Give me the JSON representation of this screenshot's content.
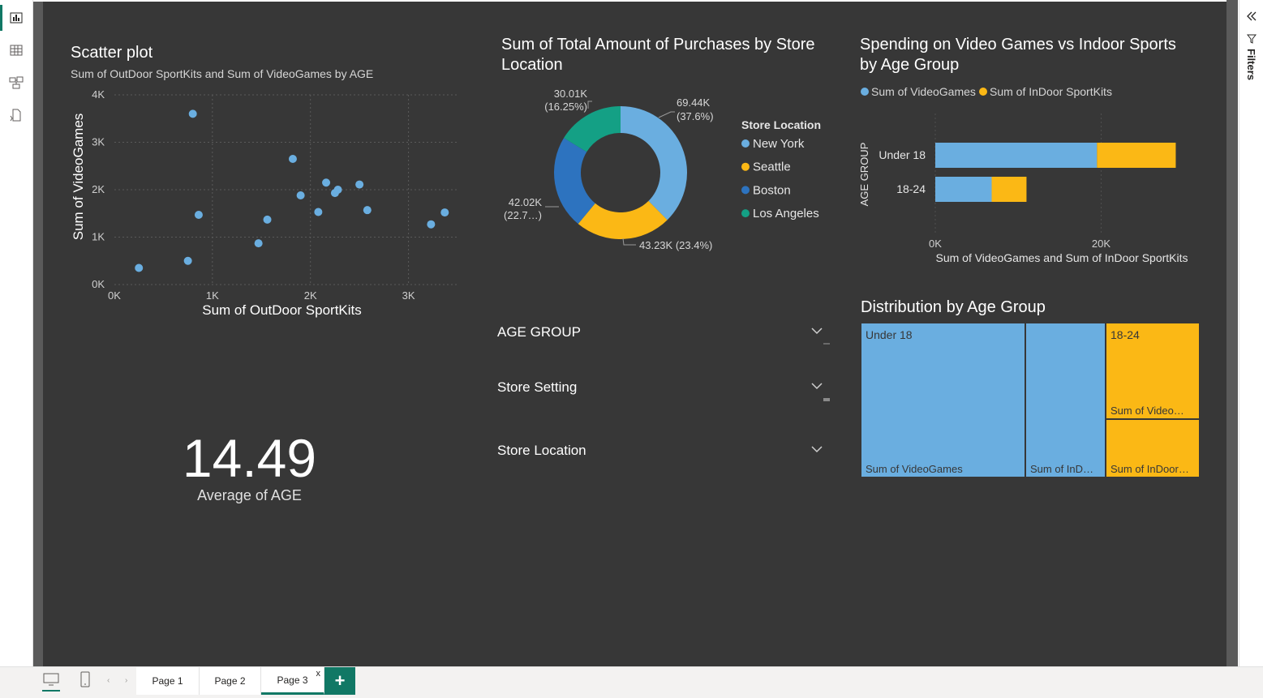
{
  "nav": {
    "items": [
      {
        "name": "report-view-icon",
        "active": true
      },
      {
        "name": "table-view-icon",
        "active": false
      },
      {
        "name": "model-view-icon",
        "active": false
      },
      {
        "name": "dax-query-icon",
        "active": false
      }
    ]
  },
  "filters_pane": {
    "label": "Filters"
  },
  "colors": {
    "canvas": "#373737",
    "accent": "#117865",
    "blue_light": "#6aaee0",
    "yellow": "#fbb815",
    "blue_dark": "#2d73bf",
    "teal": "#14a085"
  },
  "scatter": {
    "title": "Scatter plot",
    "subtitle": "Sum of OutDoor SportKits and Sum of VideoGames by AGE"
  },
  "kpi": {
    "value": "14.49",
    "label": "Average of AGE"
  },
  "donut": {
    "title_line1": "Sum of Total Amount of Purchases by Store",
    "title_line2": "Location",
    "legend_title": "Store Location",
    "labels": {
      "ny_1": "69.44K",
      "ny_2": "(37.6%)",
      "sea": "43.23K (23.4%)",
      "bos_1": "42.02K",
      "bos_2": "(22.7…)",
      "la_1": "30.01K",
      "la_2": "(16.25%)"
    }
  },
  "slicers": [
    {
      "label": "AGE GROUP"
    },
    {
      "label": "Store Setting"
    },
    {
      "label": "Store Location"
    }
  ],
  "stacked": {
    "title_line1": "Spending on Video Games vs Indoor Sports",
    "title_line2": "by Age Group",
    "legend": [
      "Sum of VideoGames",
      "Sum of InDoor SportKits"
    ],
    "ylabel": "AGE GROUP",
    "xlabel": "Sum of VideoGames and Sum of InDoor SportKits",
    "ticks": [
      "0K",
      "20K"
    ]
  },
  "treemap": {
    "title": "Distribution by Age Group",
    "labels": {
      "under18": "Under 18",
      "u18_vg": "Sum of VideoGames",
      "u18_in": "Sum of InD…",
      "g1824": "18-24",
      "g1824_vg": "Sum of Video…",
      "g1824_in": "Sum of InDoor…"
    }
  },
  "pages": {
    "tabs": [
      "Page 1",
      "Page 2",
      "Page 3"
    ],
    "active": "Page 3",
    "close": "x",
    "add": "+"
  },
  "chart_data": [
    {
      "type": "scatter",
      "title": "Scatter plot",
      "subtitle": "Sum of OutDoor SportKits and Sum of VideoGames by AGE",
      "xlabel": "Sum of OutDoor SportKits",
      "ylabel": "Sum of VideoGames",
      "x_ticks": [
        "0K",
        "1K",
        "2K",
        "3K"
      ],
      "y_ticks": [
        "0K",
        "1K",
        "2K",
        "3K",
        "4K"
      ],
      "xlim": [
        0,
        3500
      ],
      "ylim": [
        0,
        4000
      ],
      "grid": true,
      "points": [
        {
          "x": 250,
          "y": 350
        },
        {
          "x": 750,
          "y": 500
        },
        {
          "x": 800,
          "y": 3600
        },
        {
          "x": 860,
          "y": 1470
        },
        {
          "x": 1470,
          "y": 870
        },
        {
          "x": 1560,
          "y": 1370
        },
        {
          "x": 1820,
          "y": 2650
        },
        {
          "x": 1900,
          "y": 1880
        },
        {
          "x": 2080,
          "y": 1530
        },
        {
          "x": 2160,
          "y": 2150
        },
        {
          "x": 2250,
          "y": 1930
        },
        {
          "x": 2280,
          "y": 2000
        },
        {
          "x": 2500,
          "y": 2110
        },
        {
          "x": 2580,
          "y": 1570
        },
        {
          "x": 3230,
          "y": 1270
        },
        {
          "x": 3370,
          "y": 1520
        }
      ]
    },
    {
      "type": "pie",
      "donut": true,
      "title": "Sum of Total Amount of Purchases by Store Location",
      "legend_title": "Store Location",
      "legend_position": "right",
      "categories": [
        "New York",
        "Seattle",
        "Boston",
        "Los Angeles"
      ],
      "values": [
        69440,
        43230,
        42020,
        30010
      ],
      "percents": [
        37.6,
        23.4,
        22.7,
        16.25
      ]
    },
    {
      "type": "bar",
      "orientation": "horizontal",
      "stacked": true,
      "title": "Spending on Video Games vs Indoor Sports by Age Group",
      "categories": [
        "Under 18",
        "18-24"
      ],
      "series": [
        {
          "name": "Sum of VideoGames",
          "values": [
            19500,
            6800
          ]
        },
        {
          "name": "Sum of InDoor SportKits",
          "values": [
            9500,
            4200
          ]
        }
      ],
      "xlabel": "Sum of VideoGames and Sum of InDoor SportKits",
      "ylabel": "AGE GROUP",
      "xlim": [
        0,
        31500
      ],
      "legend_position": "top-left"
    },
    {
      "type": "treemap",
      "title": "Distribution by Age Group",
      "groups": [
        {
          "name": "Under 18",
          "children": [
            {
              "name": "Sum of VideoGames",
              "value": 19500
            },
            {
              "name": "Sum of InDoor SportKits",
              "value": 9500
            }
          ]
        },
        {
          "name": "18-24",
          "children": [
            {
              "name": "Sum of VideoGames",
              "value": 6800
            },
            {
              "name": "Sum of InDoor SportKits",
              "value": 4200
            }
          ]
        }
      ]
    }
  ]
}
